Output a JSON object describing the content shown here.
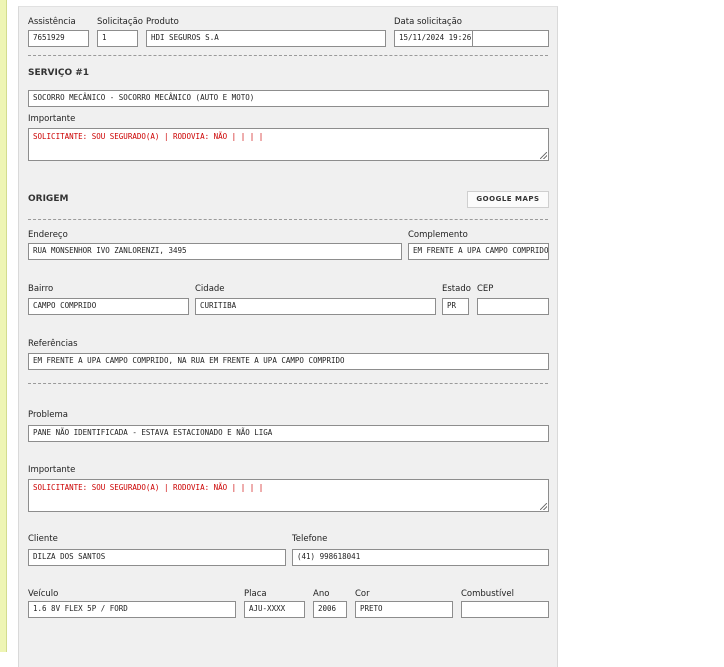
{
  "header": {
    "assistencia": {
      "label": "Assistência",
      "value": "7651929"
    },
    "solicitacao": {
      "label": "Solicitação",
      "value": "1"
    },
    "produto": {
      "label": "Produto",
      "value": "HDI SEGUROS S.A"
    },
    "data_solicitacao": {
      "label": "Data solicitação",
      "value": "15/11/2024 19:26",
      "extra": ""
    }
  },
  "servico": {
    "title": "SERVIÇO #1",
    "tipo": "SOCORRO MECÂNICO - SOCORRO MECÂNICO (AUTO E MOTO)",
    "importante_label": "Importante",
    "importante_value": "SOLICITANTE: SOU SEGURADO(A) | RODOVIA: NÃO |  |  |  |"
  },
  "origem": {
    "title": "ORIGEM",
    "google_maps_label": "GOOGLE MAPS",
    "endereco": {
      "label": "Endereço",
      "value": "RUA MONSENHOR IVO ZANLORENZI, 3495"
    },
    "complemento": {
      "label": "Complemento",
      "value": "EM FRENTE A UPA CAMPO COMPRIDO"
    },
    "bairro": {
      "label": "Bairro",
      "value": "CAMPO COMPRIDO"
    },
    "cidade": {
      "label": "Cidade",
      "value": "CURITIBA"
    },
    "estado": {
      "label": "Estado",
      "value": "PR"
    },
    "cep": {
      "label": "CEP",
      "value": ""
    },
    "referencias": {
      "label": "Referências",
      "value": "EM FRENTE A UPA CAMPO COMPRIDO, NA RUA EM FRENTE A UPA CAMPO COMPRIDO"
    }
  },
  "detalhes": {
    "problema": {
      "label": "Problema",
      "value": "PANE NÃO IDENTIFICADA - ESTAVA ESTACIONADO E NÃO LIGA"
    },
    "importante_label": "Importante",
    "importante_value": "SOLICITANTE: SOU SEGURADO(A) | RODOVIA: NÃO |  |  |  |",
    "cliente": {
      "label": "Cliente",
      "value": "DILZA DOS SANTOS"
    },
    "telefone": {
      "label": "Telefone",
      "value": "(41) 998618041"
    },
    "veiculo": {
      "label": "Veículo",
      "value": "1.6 8V FLEX 5P / FORD"
    },
    "placa": {
      "label": "Placa",
      "value": "AJU-XXXX"
    },
    "ano": {
      "label": "Ano",
      "value": "2006"
    },
    "cor": {
      "label": "Cor",
      "value": "PRETO"
    },
    "combustivel": {
      "label": "Combustível",
      "value": ""
    }
  },
  "colors": {
    "warning_text": "#cc0000",
    "panel_bg": "#f0f0f0",
    "left_strip": "#eef5b4"
  }
}
